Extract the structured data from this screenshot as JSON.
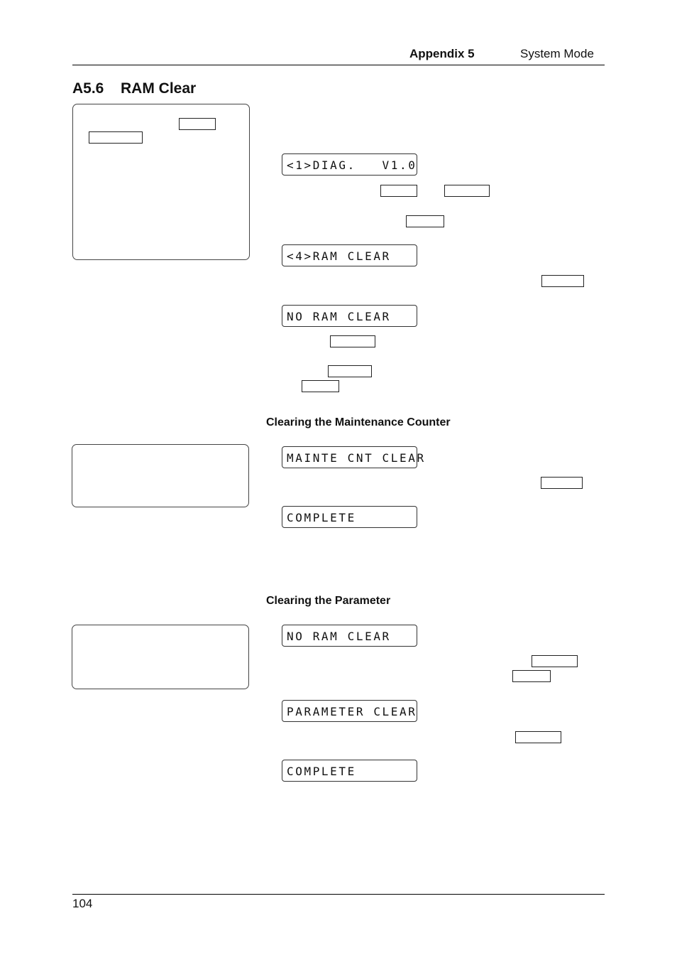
{
  "header": {
    "chapter": "Appendix 5",
    "title": "System Mode"
  },
  "section": {
    "number": "A5.6",
    "title": "RAM Clear"
  },
  "ram_clear_steps": {
    "lcd_displays": [
      "<1>DIAG.   V1.0",
      "<4>RAM CLEAR",
      "NO RAM CLEAR"
    ]
  },
  "maintenance_counter": {
    "heading": "Clearing the Maintenance Counter",
    "lcd_displays": [
      "MAINTE CNT CLEAR",
      "COMPLETE"
    ]
  },
  "parameter": {
    "heading": "Clearing the Parameter",
    "lcd_displays": [
      "NO RAM CLEAR",
      "PARAMETER CLEAR",
      "COMPLETE"
    ]
  },
  "footer": {
    "page_number": "104"
  }
}
